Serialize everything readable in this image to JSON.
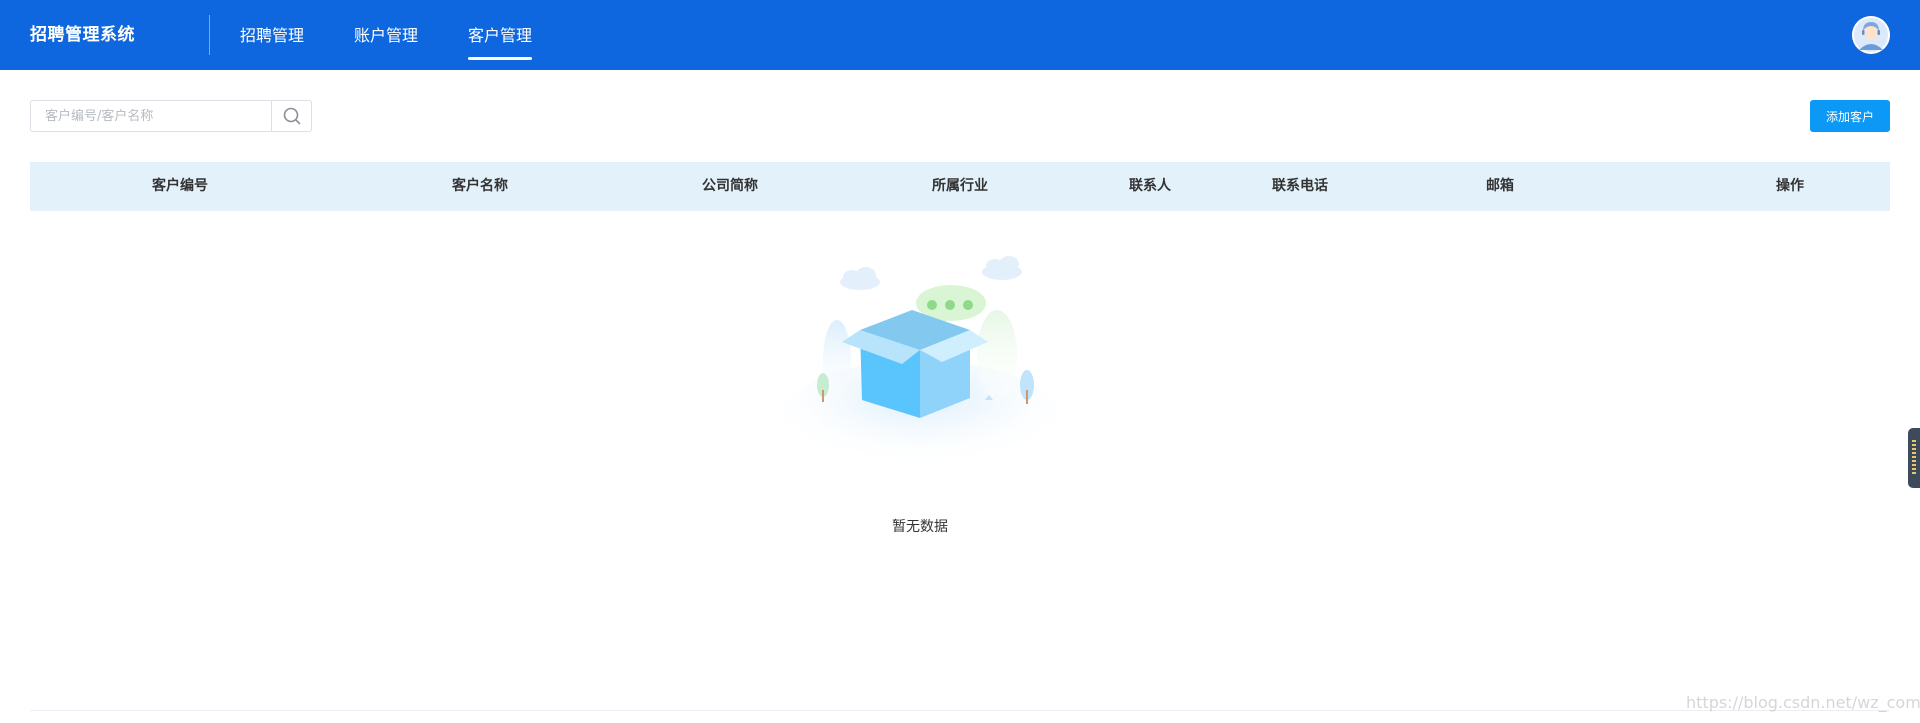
{
  "header": {
    "brand": "招聘管理系统",
    "nav": [
      {
        "label": "招聘管理",
        "active": false
      },
      {
        "label": "账户管理",
        "active": false
      },
      {
        "label": "客户管理",
        "active": true
      }
    ],
    "avatar_icon": "user-avatar-icon"
  },
  "toolbar": {
    "search_placeholder": "客户编号/客户名称",
    "search_value": "",
    "search_icon": "search-icon",
    "add_button": "添加客户"
  },
  "table": {
    "columns": [
      "客户编号",
      "客户名称",
      "公司简称",
      "所属行业",
      "联系人",
      "联系电话",
      "邮箱",
      "操作"
    ],
    "rows": [],
    "empty_text": "暂无数据",
    "empty_icon": "empty-box-icon"
  },
  "watermark": "https://blog.csdn.net/wz_coming",
  "colors": {
    "header_bg": "#0e67de",
    "primary_button": "#0c99f5",
    "table_header_bg": "#e3f1fb"
  }
}
